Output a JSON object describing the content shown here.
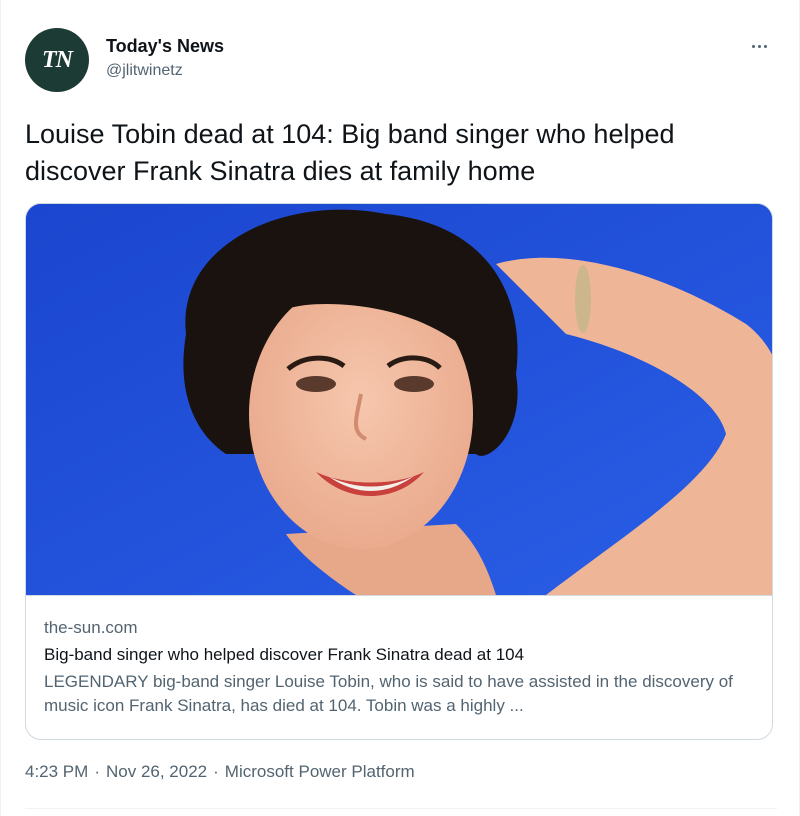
{
  "author": {
    "avatar_initials": "TN",
    "display_name": "Today's News",
    "handle": "@jlitwinetz"
  },
  "tweet": {
    "text": "Louise Tobin dead at 104: Big band singer who helped discover Frank Sinatra dies at family home"
  },
  "card": {
    "image_alt": "Louise Tobin smiling against a blue sky",
    "domain": "the-sun.com",
    "title": "Big-band singer who helped discover Frank Sinatra dead at 104",
    "description": "LEGENDARY big-band singer Louise Tobin, who is said to have assisted in the discovery of music icon Frank Sinatra, has died at 104. Tobin was a highly ..."
  },
  "meta": {
    "time": "4:23 PM",
    "date": "Nov 26, 2022",
    "source": "Microsoft Power Platform",
    "separator": "·"
  },
  "icons": {
    "more": "more-horizontal-icon"
  },
  "colors": {
    "avatar_bg": "#1d3b35",
    "secondary_text": "#536471",
    "border": "#cfd9de",
    "sky": "#1e4fd8"
  }
}
